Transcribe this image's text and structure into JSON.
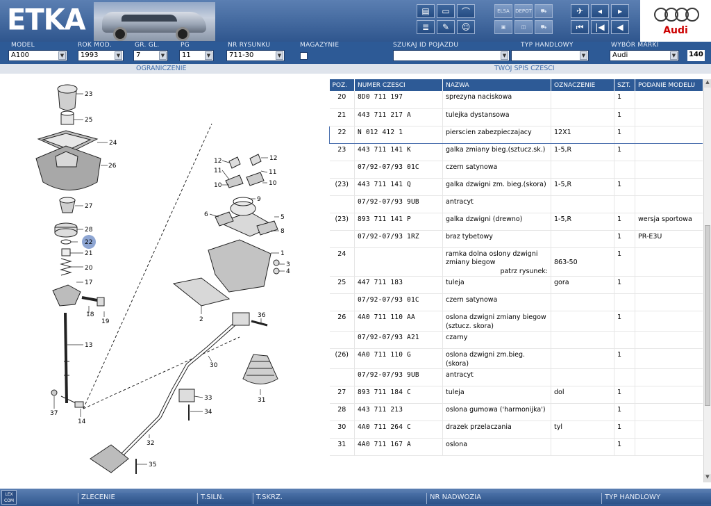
{
  "app": {
    "title": "ETKA",
    "brand": "Audi"
  },
  "toolbar": {
    "group1": [
      "print-icon",
      "screen-icon",
      "dolphin-icon",
      "list-icon",
      "pencil-icon",
      "person-icon"
    ],
    "group2": [
      "elsa-icon",
      "depot-icon",
      "cart-icon",
      "pc-icon",
      "window-icon",
      "cart2-icon"
    ],
    "group3": [
      "pin-icon",
      "doc-back-icon",
      "doc-next-icon",
      "skip-first-icon",
      "prev-icon",
      "back-icon"
    ],
    "group2_labels": [
      "ELSA",
      "DEPOT"
    ]
  },
  "fields": {
    "model": {
      "label": "MODEL",
      "value": "A100"
    },
    "rok": {
      "label": "ROK MOD.",
      "value": "1993"
    },
    "grgl": {
      "label": "GR. GL.",
      "value": "7"
    },
    "pg": {
      "label": "PG",
      "value": "11"
    },
    "nrrys": {
      "label": "NR RYSUNKU",
      "value": "711-30"
    },
    "magazynie": {
      "label": "MAGAZYNIE"
    },
    "szukaj": {
      "label": "SZUKAJ ID POJAZDU",
      "value": ""
    },
    "typ": {
      "label": "TYP HANDLOWY",
      "value": ""
    },
    "marka": {
      "label": "WYBÓR MARKI",
      "value": "Audi"
    },
    "count": "140"
  },
  "sections": {
    "left": "OGRANICZENIE",
    "right": "TWÓJ SPIS CZESCI"
  },
  "table": {
    "headers": [
      "POZ.",
      "NUMER CZESCI",
      "NAZWA",
      "OZNACZENIE",
      "SZT.",
      "PODANIE MODELU"
    ],
    "rows": [
      {
        "poz": "20",
        "nr": "8D0  711  197",
        "nazwa": "sprezyna naciskowa",
        "ozn": "",
        "szt": "1",
        "model": ""
      },
      {
        "poz": "21",
        "nr": "443  711  217  A",
        "nazwa": "tulejka dystansowa",
        "ozn": "",
        "szt": "1",
        "model": ""
      },
      {
        "poz": "22",
        "nr": "N   012  412  1",
        "nazwa": "pierscien zabezpieczajacy",
        "ozn": "12X1",
        "szt": "1",
        "model": "",
        "selected": true
      },
      {
        "poz": "23",
        "nr": "443  711  141  K",
        "nazwa": "galka zmiany bieg.(sztucz.sk.)",
        "ozn": "1-5,R",
        "szt": "1",
        "model": ""
      },
      {
        "poz": "",
        "nr": "07/92-07/93  01C",
        "nazwa": "czern satynowa",
        "ozn": "",
        "szt": "",
        "model": ""
      },
      {
        "poz": "(23)",
        "nr": "443  711  141  Q",
        "nazwa": "galka dzwigni zm. bieg.(skora)",
        "ozn": "1-5,R",
        "szt": "1",
        "model": ""
      },
      {
        "poz": "",
        "nr": "07/92-07/93  9UB",
        "nazwa": "antracyt",
        "ozn": "",
        "szt": "",
        "model": ""
      },
      {
        "poz": "(23)",
        "nr": "893  711  141  P",
        "nazwa": "galka dzwigni (drewno)",
        "ozn": "1-5,R",
        "szt": "1",
        "model": "wersja sportowa"
      },
      {
        "poz": "",
        "nr": "07/92-07/93  1RZ",
        "nazwa": "braz tybetowy",
        "ozn": "",
        "szt": "1",
        "model": "PR-E3U"
      },
      {
        "poz": "24",
        "nr": "",
        "nazwa": "ramka dolna oslony dzwigni zmiany biegow",
        "ozn": "",
        "szt": "1",
        "model": "",
        "ref_label": "patrz rysunek:",
        "ref_value": "863-50"
      },
      {
        "poz": "25",
        "nr": "447  711  183",
        "nazwa": "tuleja",
        "ozn": "gora",
        "szt": "1",
        "model": ""
      },
      {
        "poz": "",
        "nr": "07/92-07/93  01C",
        "nazwa": "czern satynowa",
        "ozn": "",
        "szt": "",
        "model": ""
      },
      {
        "poz": "26",
        "nr": "4A0  711  110  AA",
        "nazwa": "oslona dzwigni zmiany biegow (sztucz. skora)",
        "ozn": "",
        "szt": "1",
        "model": ""
      },
      {
        "poz": "",
        "nr": "07/92-07/93  A21",
        "nazwa": "czarny",
        "ozn": "",
        "szt": "",
        "model": ""
      },
      {
        "poz": "(26)",
        "nr": "4A0  711  110  G",
        "nazwa": "oslona dzwigni zm.bieg.(skora)",
        "ozn": "",
        "szt": "1",
        "model": ""
      },
      {
        "poz": "",
        "nr": "07/92-07/93  9UB",
        "nazwa": "antracyt",
        "ozn": "",
        "szt": "",
        "model": ""
      },
      {
        "poz": "27",
        "nr": "893  711  184  C",
        "nazwa": "tuleja",
        "ozn": "dol",
        "szt": "1",
        "model": ""
      },
      {
        "poz": "28",
        "nr": "443  711  213",
        "nazwa": "oslona gumowa ('harmonijka')",
        "ozn": "",
        "szt": "1",
        "model": ""
      },
      {
        "poz": "30",
        "nr": "4A0  711  264  C",
        "nazwa": "drazek przelaczania",
        "ozn": "tyl",
        "szt": "1",
        "model": ""
      },
      {
        "poz": "31",
        "nr": "4A0  711  167  A",
        "nazwa": "oslona",
        "ozn": "",
        "szt": "1",
        "model": ""
      }
    ]
  },
  "diagram": {
    "callouts": [
      "23",
      "25",
      "24",
      "26",
      "27",
      "28",
      "22",
      "21",
      "20",
      "17",
      "18",
      "19",
      "13",
      "37",
      "14",
      "12",
      "11",
      "10",
      "12",
      "11",
      "10",
      "9",
      "6",
      "5",
      "8",
      "1",
      "3",
      "4",
      "2",
      "36",
      "30",
      "31",
      "33",
      "34",
      "32",
      "35"
    ],
    "highlight": "22"
  },
  "footer": {
    "logo": "LEX COM",
    "buttons": [
      "ZLECENIE",
      "T.SILN.",
      "T.SKRZ.",
      "NR NADWOZIA",
      "TYP HANDLOWY"
    ]
  }
}
